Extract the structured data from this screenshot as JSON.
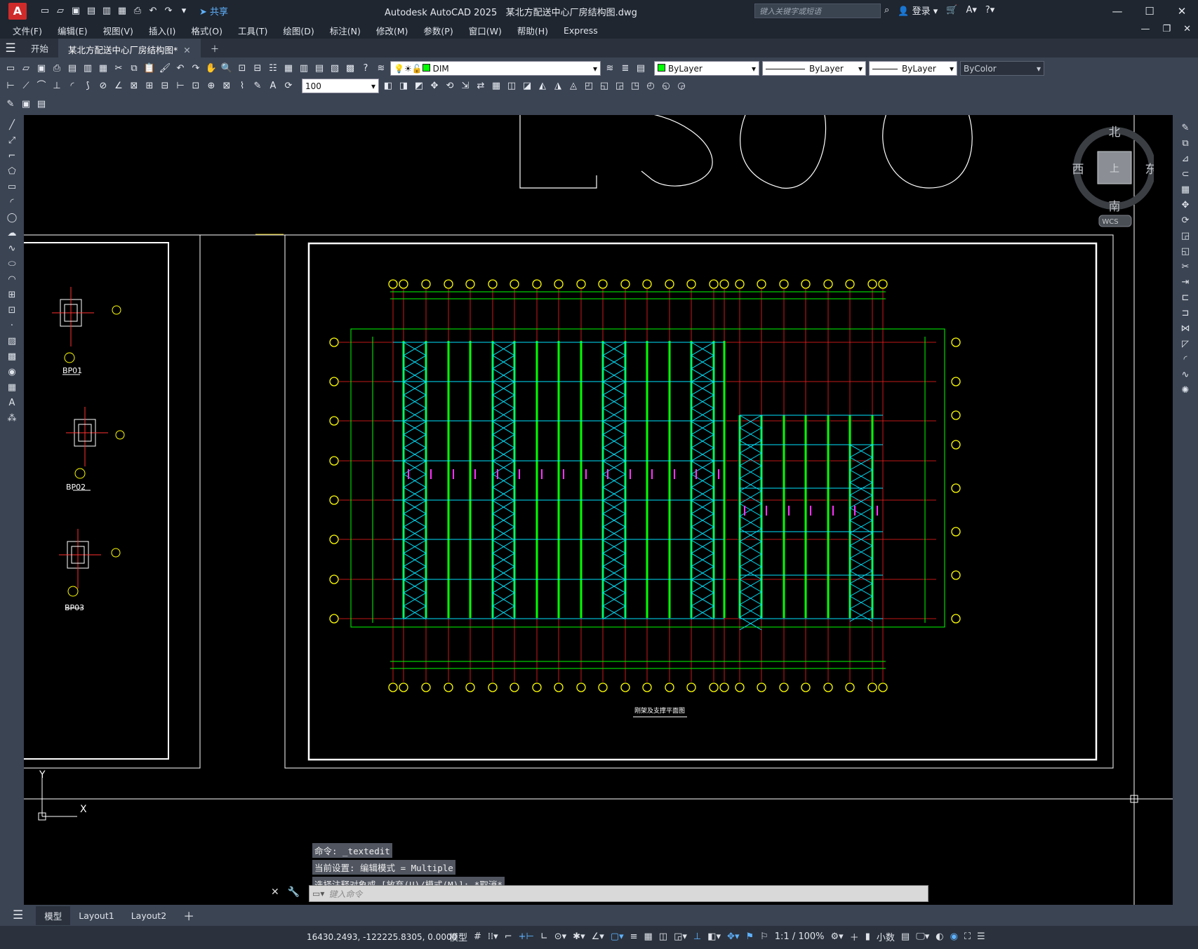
{
  "window": {
    "app_title": "Autodesk AutoCAD 2025",
    "file_title": "某北方配送中心厂房结构图.dwg",
    "search_placeholder": "键入关键字或短语",
    "sign_in": "登录",
    "share": "共享"
  },
  "menu": [
    "文件(F)",
    "编辑(E)",
    "视图(V)",
    "插入(I)",
    "格式(O)",
    "工具(T)",
    "绘图(D)",
    "标注(N)",
    "修改(M)",
    "参数(P)",
    "窗口(W)",
    "帮助(H)",
    "Express"
  ],
  "tabs": {
    "start": "开始",
    "document": "某北方配送中心厂房结构图*"
  },
  "properties": {
    "layer": "DIM",
    "color": "ByLayer",
    "linetype": "ByLayer",
    "lineweight": "ByLayer",
    "plotstyle": "ByColor",
    "layer_swatch": "#00ff00",
    "color_swatch": "#00ff00",
    "dim_scale": "100"
  },
  "viewcube": {
    "north": "北",
    "south": "南",
    "east": "东",
    "west": "西",
    "face": "上",
    "wcs": "WCS"
  },
  "drawing": {
    "bp01": "BP01",
    "bp02": "BP02",
    "bp03": "BP03",
    "plan_title": "刚架及支撑平面图",
    "ucs_y": "Y",
    "ucs_x": "X"
  },
  "command": {
    "history": [
      "命令: _textedit",
      "当前设置: 编辑模式 = Multiple",
      "选择注释对象或 [放弃(U)/模式(M)]: *取消*"
    ],
    "placeholder": "键入命令"
  },
  "layouts": [
    "模型",
    "Layout1",
    "Layout2"
  ],
  "status": {
    "coordinates": "16430.2493, -122225.8305, 0.0000",
    "mode": "模型",
    "scale": "1:1 / 100%",
    "units": "小数"
  }
}
